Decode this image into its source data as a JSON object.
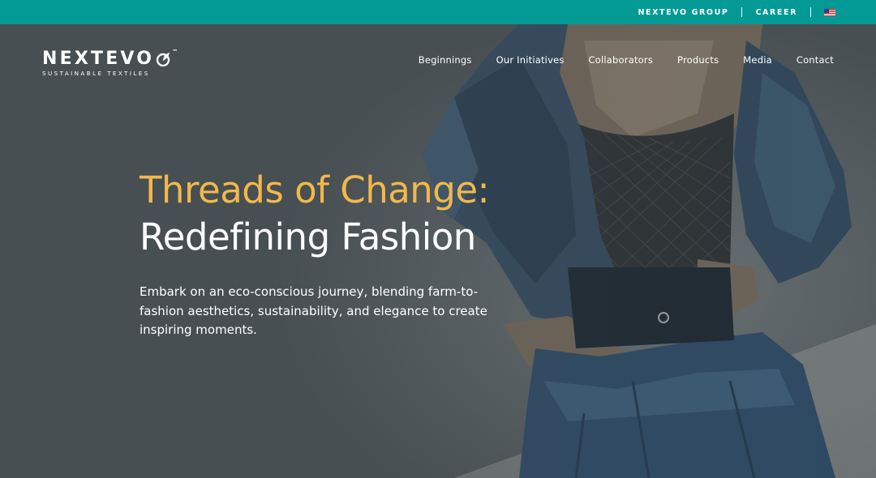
{
  "topbar": {
    "group_label": "NEXTEVO GROUP",
    "career_label": "CAREER",
    "language_icon": "us-flag-icon"
  },
  "logo": {
    "wordmark": "NEXTEVO",
    "trademark": "™",
    "tagline": "SUSTAINABLE TEXTILES"
  },
  "nav": {
    "items": [
      {
        "label": "Beginnings"
      },
      {
        "label": "Our Initiatives"
      },
      {
        "label": "Collaborators"
      },
      {
        "label": "Products"
      },
      {
        "label": "Media"
      },
      {
        "label": "Contact"
      }
    ]
  },
  "hero": {
    "headline_line1": "Threads of Change:",
    "headline_line2": "Redefining Fashion",
    "description": "Embark on an eco-conscious journey, blending farm-to-fashion aesthetics, sustainability, and elegance to create inspiring moments."
  },
  "colors": {
    "topbar_bg": "#039a96",
    "accent_yellow": "#f2b84b",
    "hero_bg": "#4a5356",
    "text": "#ffffff"
  }
}
